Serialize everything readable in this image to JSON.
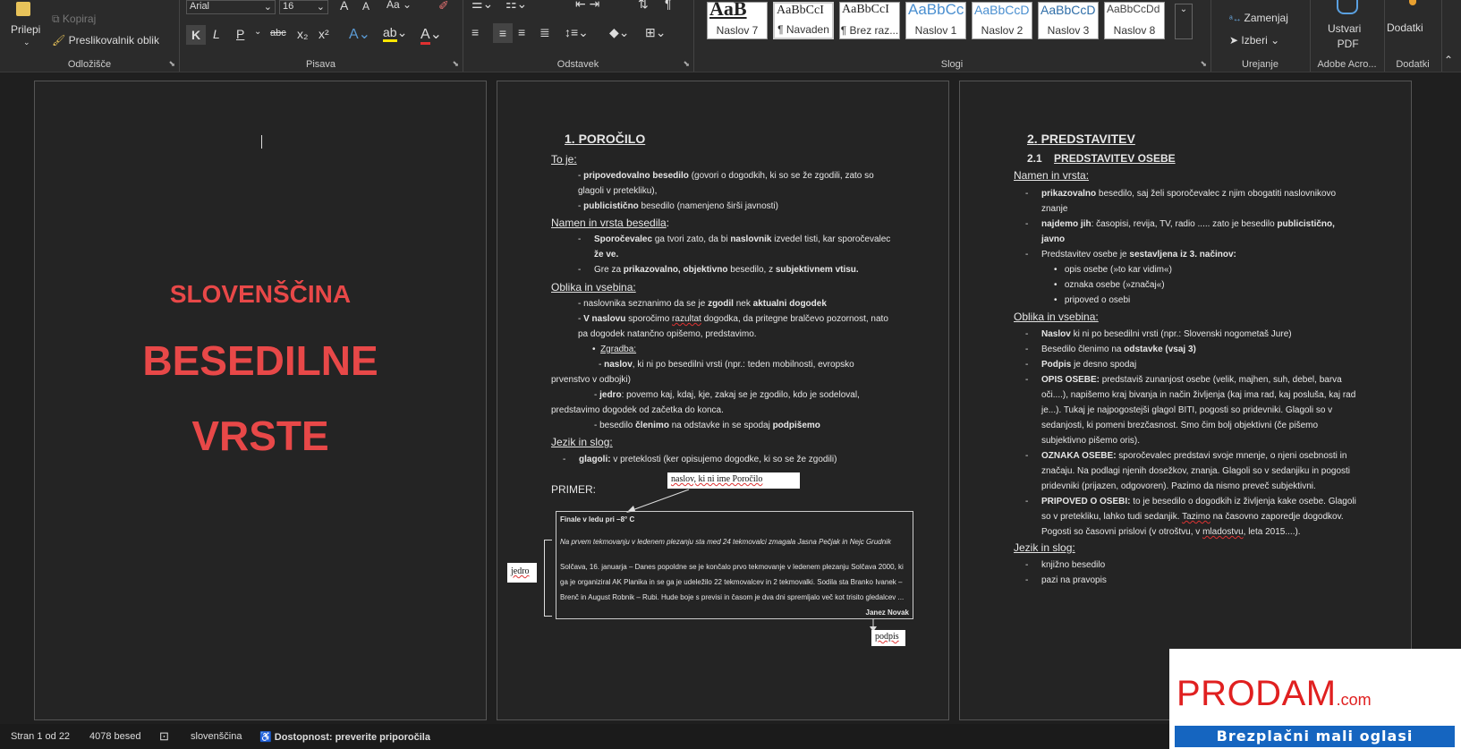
{
  "ribbon": {
    "clipboard": {
      "paste": "Prilepi",
      "copy": "Kopiraj",
      "format_painter": "Preslikovalnik oblik",
      "label": "Odložišče"
    },
    "font": {
      "font_name": "Arial",
      "font_size": "16",
      "bold": "K",
      "italic": "L",
      "underline": "P",
      "strike": "abc",
      "label": "Pisava"
    },
    "paragraph": {
      "label": "Odstavek"
    },
    "styles": {
      "label": "Slogi",
      "items": [
        {
          "preview": "AaB",
          "name": "Naslov 7"
        },
        {
          "preview": "AaBbCcI",
          "name": "¶ Navaden"
        },
        {
          "preview": "AaBbCcI",
          "name": "¶ Brez raz..."
        },
        {
          "preview": "AaBbCc",
          "name": "Naslov 1"
        },
        {
          "preview": "AaBbCcD",
          "name": "Naslov 2"
        },
        {
          "preview": "AaBbCcD",
          "name": "Naslov 3"
        },
        {
          "preview": "AaBbCcDd",
          "name": "Naslov 8"
        }
      ]
    },
    "editing": {
      "replace": "Zamenjaj",
      "select": "Izberi",
      "label": "Urejanje"
    },
    "adobe": {
      "create_pdf_1": "Ustvari",
      "create_pdf_2": "PDF",
      "label": "Adobe Acro..."
    },
    "addins": {
      "button": "Dodatki",
      "label": "Dodatki"
    }
  },
  "page1": {
    "line1": "SLOVENŠČINA",
    "line2": "BESEDILNE",
    "line3": "VRSTE"
  },
  "page2": {
    "title_num": "1.",
    "title": "POROČILO",
    "to_je": "To je:",
    "l1a": "- ",
    "l1b": "pripovedovalno besedilo",
    "l1c": " (govori o dogodkih, ki so se že zgodili, zato so",
    "l2": "glagoli v pretekliku),",
    "l3a": "- ",
    "l3b": "publicistično",
    "l3c": " besedilo (namenjeno širši javnosti)",
    "namen": "Namen in vrsta besedila",
    "namen_colon": ":",
    "n1a": "Sporočevalec",
    "n1b": " ga tvori zato, da bi ",
    "n1c": "naslovnik",
    "n1d": " izvedel tisti, kar sporočevalec",
    "n2": "že ve.",
    "n3a": "Gre za ",
    "n3b": "prikazovalno, objektivno",
    "n3c": " besedilo, z ",
    "n3d": "subjektivnem vtisu.",
    "oblika": "Oblika in vsebina:",
    "o1a": "- naslovnika seznanimo da se je ",
    "o1b": "zgodil",
    "o1c": " nek ",
    "o1d": "aktualni dogodek",
    "o2a": "- ",
    "o2b": "V naslovu",
    "o2c": " sporočimo ",
    "o2d": "razultat",
    "o2e": " dogodka, da pritegne bralčevo pozornost, nato",
    "o3": "pa dogodek natančno opišemo, predstavimo.",
    "zgradba": "Zgradba:",
    "z1a": "- ",
    "z1b": "naslov",
    "z1c": ", ki ni po besedilni vrsti (npr.: teden mobilnosti, evropsko",
    "z2": "prvenstvo v odbojki)",
    "z3a": "- ",
    "z3b": "jedro",
    "z3c": ": povemo kaj, kdaj, kje, zakaj se je zgodilo, kdo je sodeloval,",
    "z4": "predstavimo dogodek od začetka do konca.",
    "z5a": "- besedilo ",
    "z5b": "členimo",
    "z5c": " na odstavke in se spodaj ",
    "z5d": "podpišemo",
    "jezik": "Jezik in slog:",
    "j1a": "glagoli:",
    "j1b": " v preteklosti (ker opisujemo dogodke, ki so se že zgodili)",
    "primer": "PRIMER:",
    "callout_title": "naslov, ki ni ime Poročilo",
    "callout_jedro": "jedro",
    "callout_podpis": "podpis",
    "news_title": "Finale v ledu pri –8° C",
    "news_lead": "Na prvem tekmovanju v ledenem plezanju sta med 24 tekmovalci zmagala Jasna Pečjak in Nejc Grudnik",
    "news_b1": "Solčava, 16. januarja – Danes popoldne se je končalo prvo tekmovanje v ledenem plezanju Solčava 2000, ki",
    "news_b2": "ga je organiziral AK Planika in se ga je udeležilo 22 tekmovalcev in 2 tekmovalki. Sodila sta Branko Ivanek –",
    "news_b3": "Brenč in August Robnik – Rubi. Hude boje s previsi in časom je dva dni spremljalo več kot trisito gledalcev ...",
    "news_sign": "Janez Novak"
  },
  "page3": {
    "title_num": "2.",
    "title": "PREDSTAVITEV",
    "sub_num": "2.1",
    "sub": "PREDSTAVITEV OSEBE",
    "namen": "Namen in vrsta:",
    "n1a": "prikazovalno",
    "n1b": " besedilo, saj želi sporočevalec z njim obogatiti naslovnikovo",
    "n1c": "znanje",
    "n2a": "najdemo jih",
    "n2b": ": časopisi, revija, TV, radio ..... zato je besedilo ",
    "n2c": "publicistično,",
    "n2d": "javno",
    "n3a": "Predstavitev osebe je ",
    "n3b": "sestavljena iz 3. načinov:",
    "b1": "opis osebe (»to kar vidim«)",
    "b2": "oznaka osebe (»značaj«)",
    "b3": "pripoved o osebi",
    "oblika": "Oblika in vsebina:",
    "o1a": "Naslov",
    "o1b": " ki ni po besedilni vrsti  (npr.: Slovenski nogometaš Jure)",
    "o2a": "Besedilo členimo na ",
    "o2b": "odstavke (vsaj 3)",
    "o3a": "Podpis",
    "o3b": " je desno spodaj",
    "o4a": "OPIS OSEBE:",
    "o4b": " predstaviš zunanjost osebe (velik, majhen, suh, debel, barva",
    "o4c": "oči....), napišemo kraj bivanja in način življenja (kaj ima rad, kaj posluša, kaj rad",
    "o4d": "je...). Tukaj je najpogostejši glagol BITI, pogosti so pridevniki. Glagoli so v",
    "o4e": "sedanjosti, ki pomeni brezčasnost. Smo čim bolj objektivni (če pišemo",
    "o4f": "subjektivno pišemo oris).",
    "o5a": "OZNAKA OSEBE:",
    "o5b": " sporočevalec predstavi svoje mnenje, o njeni osebnosti in",
    "o5c": "značaju. Na podlagi njenih dosežkov, znanja. Glagoli so v sedanjiku in pogosti",
    "o5d": "pridevniki (prijazen, odgovoren). Pazimo da nismo preveč subjektivni.",
    "o6a": "PRIPOVED O OSEBI:",
    "o6b": " to je besedilo o dogodkih iz življenja kake osebe. Glagoli",
    "o6c": "so v pretekliku, lahko tudi sedanjik. ",
    "o6d": "Tazimo",
    "o6e": " na časovno zaporedje dogodkov.",
    "o6f": "Pogosti so časovni prislovi (v otroštvu, v ",
    "o6g": "mladostvu",
    "o6h": ", leta 2015....).",
    "jezik": "Jezik in slog:",
    "j1": "knjižno besedilo",
    "j2": "pazi na pravopis"
  },
  "status": {
    "page": "Stran 1 od 22",
    "words": "4078 besed",
    "language": "slovenščina",
    "accessibility": "Dostopnost: preverite priporočila"
  },
  "ad": {
    "brand": "PRODAM",
    "tld": ".com",
    "tagline": "Brezplačni mali oglasi"
  },
  "colors": {
    "title_red": "#e84848",
    "ad_red": "#e02020",
    "ad_blue": "#1565c0"
  }
}
